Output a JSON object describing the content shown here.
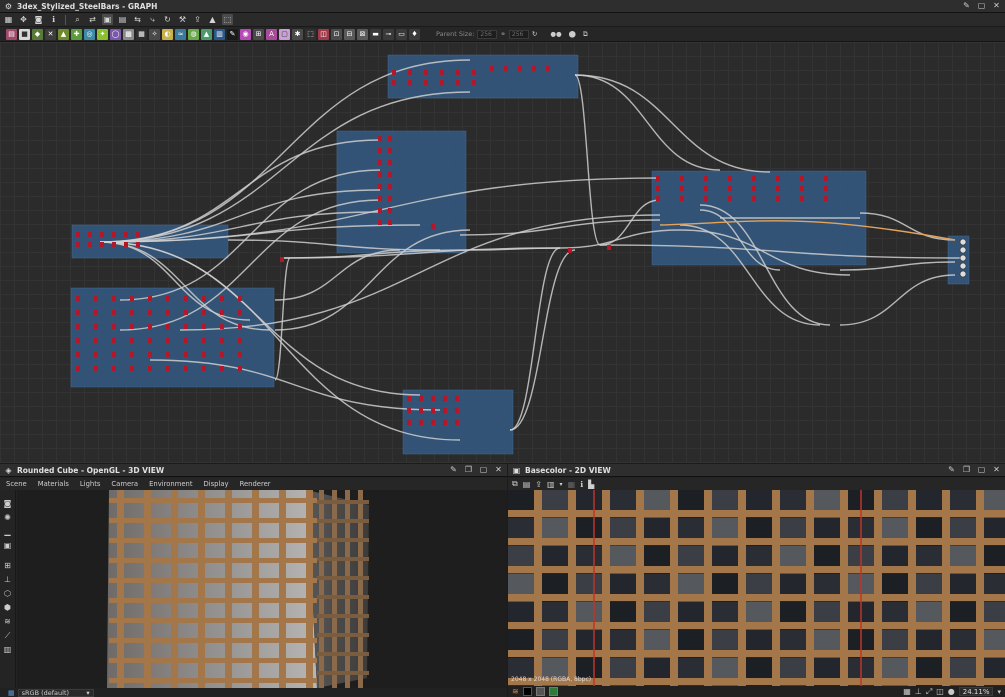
{
  "graph": {
    "title": "3dex_Stylized_SteelBars - GRAPH",
    "toolbar_icons": [
      "grid-icon",
      "move-icon",
      "camera-icon",
      "info-icon",
      "link-icon",
      "frame-icon",
      "layout-icon",
      "align-icon",
      "connect-icon",
      "refresh-icon",
      "tool-icon",
      "export-icon",
      "fill-icon",
      "select-icon"
    ],
    "parent_size_label": "Parent Size:",
    "parent_size_w": "256",
    "parent_size_h": "256"
  },
  "view3d": {
    "title": "Rounded Cube - OpenGL - 3D VIEW",
    "menu": [
      "Scene",
      "Materials",
      "Lights",
      "Camera",
      "Environment",
      "Display",
      "Renderer"
    ],
    "colorspace": "sRGB (default)"
  },
  "view2d": {
    "title": "Basecolor - 2D VIEW",
    "texture_info": "2048 x 2048 (RGBA, 8bpc)",
    "zoom": "24.11%"
  },
  "colors": {
    "frame": "#345a82",
    "node_red": "#b3172a",
    "wire": "#cfcfcf",
    "wire_orange": "#e3a35a",
    "wood": "#a4774b"
  }
}
